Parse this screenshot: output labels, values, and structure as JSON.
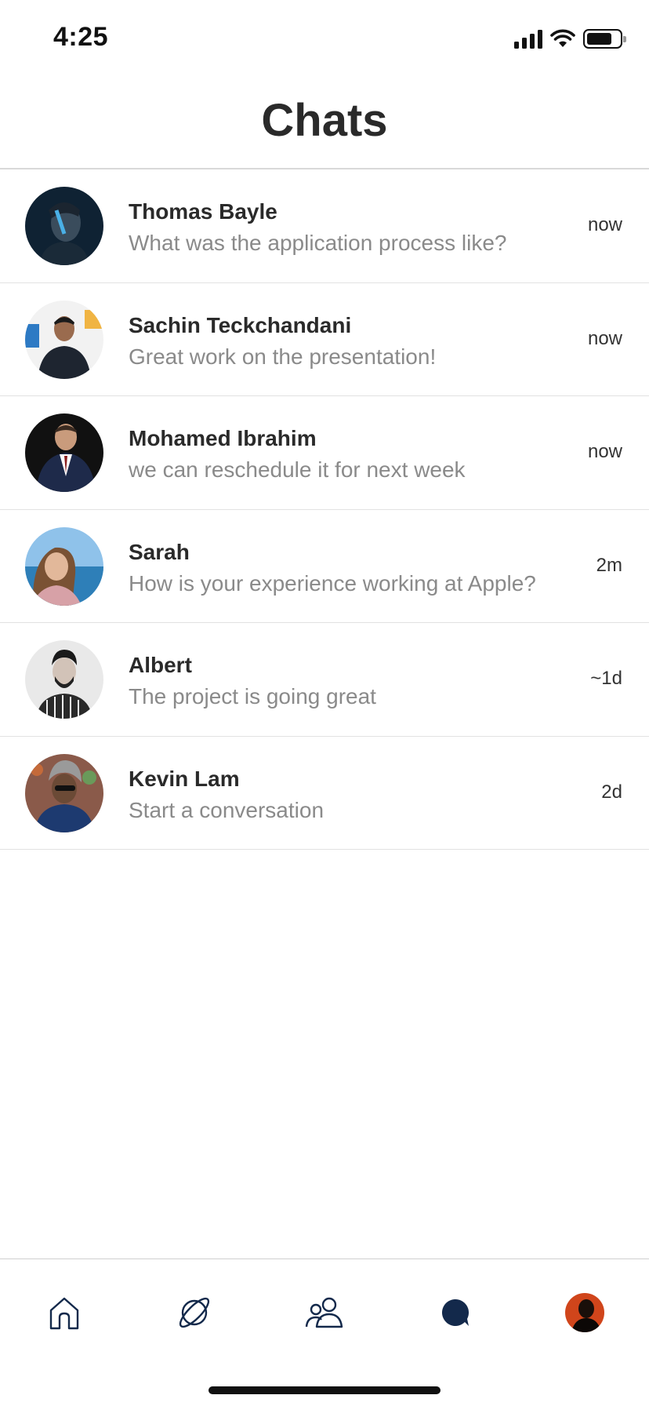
{
  "status_bar": {
    "time": "4:25"
  },
  "header": {
    "title": "Chats"
  },
  "chats": [
    {
      "name": "Thomas Bayle",
      "preview": "What was the application process like?",
      "time": "now"
    },
    {
      "name": "Sachin Teckchandani",
      "preview": "Great work on the presentation!",
      "time": "now"
    },
    {
      "name": "Mohamed Ibrahim",
      "preview": "we can reschedule it for next week",
      "time": "now"
    },
    {
      "name": "Sarah",
      "preview": "How is your experience working at Apple?",
      "time": "2m"
    },
    {
      "name": "Albert",
      "preview": "The project is going great",
      "time": "~1d"
    },
    {
      "name": "Kevin Lam",
      "preview": "Start a conversation",
      "time": "2d"
    }
  ],
  "tab_bar": {
    "tabs": [
      {
        "icon": "home-icon",
        "active": false
      },
      {
        "icon": "planet-icon",
        "active": false
      },
      {
        "icon": "people-icon",
        "active": false
      },
      {
        "icon": "chat-bubble-icon",
        "active": true
      },
      {
        "icon": "profile-avatar",
        "active": false
      }
    ]
  },
  "colors": {
    "accent": "#13294b",
    "text_primary": "#2a2a2a",
    "text_secondary": "#8a8a8a",
    "divider": "#e2e2e2"
  }
}
